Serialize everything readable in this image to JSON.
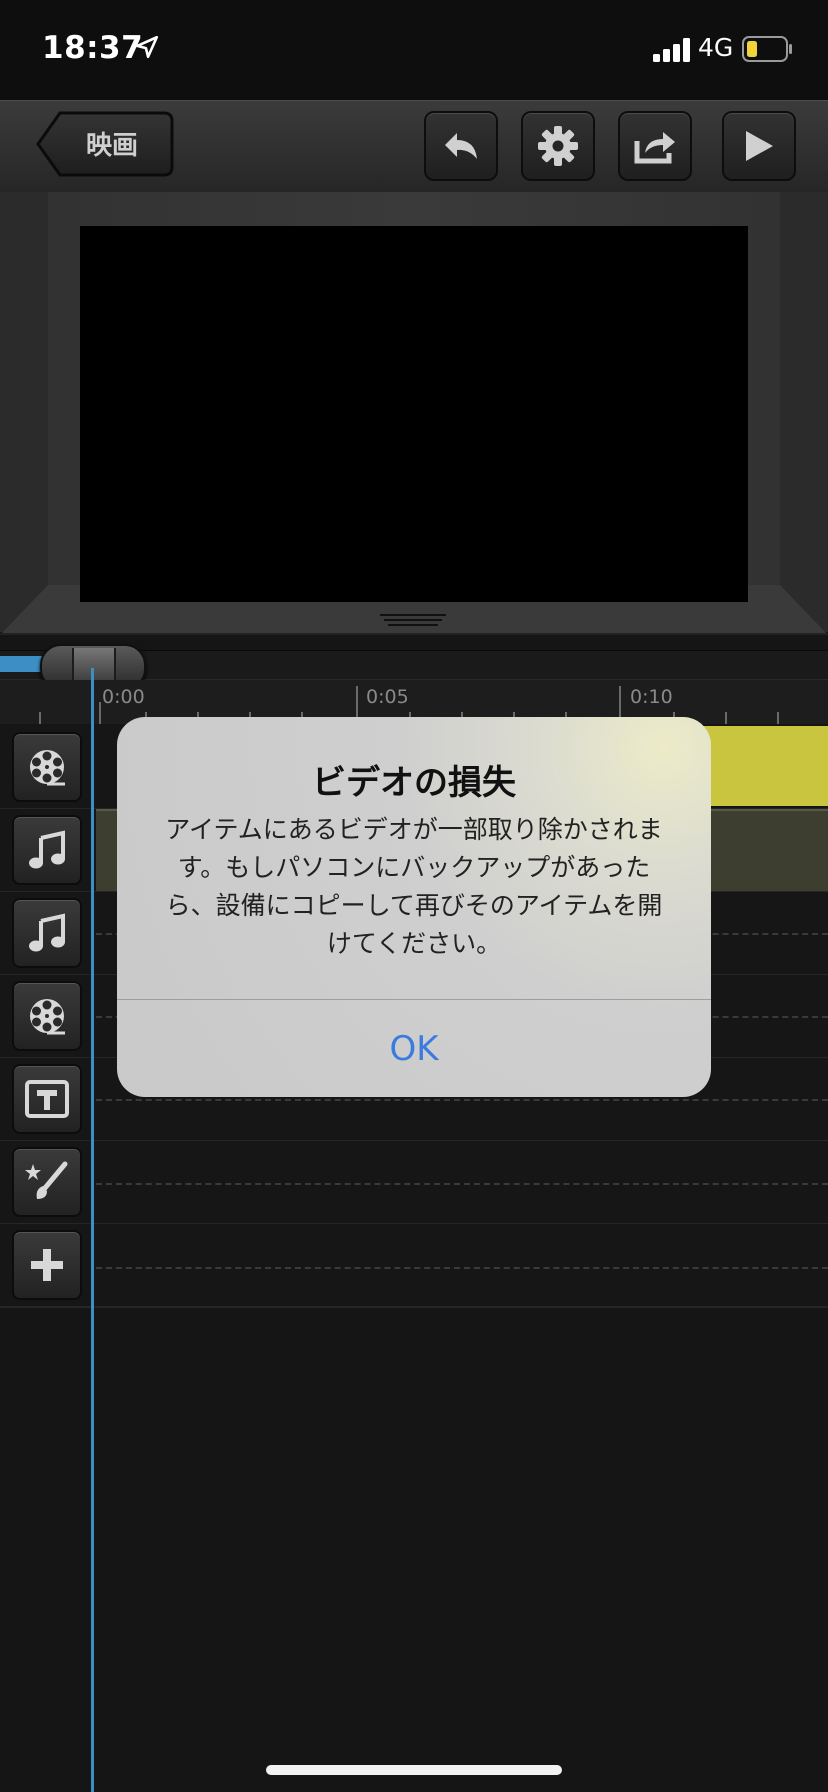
{
  "status_bar": {
    "time": "18:37",
    "network": "4G"
  },
  "toolbar": {
    "back_label": "映画"
  },
  "timeline": {
    "ticks": [
      "0:00",
      "0:05",
      "0:10"
    ]
  },
  "alert": {
    "title": "ビデオの損失",
    "message": "アイテムにあるビデオが一部取り除かされます。もしパソコンにバックアップがあったら、設備にコピーして再びそのアイテムを開けてください。",
    "ok_label": "OK"
  },
  "colors": {
    "accent": "#3c8ec4",
    "alert_button": "#3b7be0",
    "clip_video": "#c9c53e"
  },
  "icons": [
    "location-arrow-icon",
    "signal-icon",
    "battery-icon",
    "undo-icon",
    "gear-icon",
    "share-icon",
    "play-icon",
    "film-reel-icon",
    "music-note-icon",
    "text-icon",
    "effects-icon",
    "plus-icon"
  ]
}
